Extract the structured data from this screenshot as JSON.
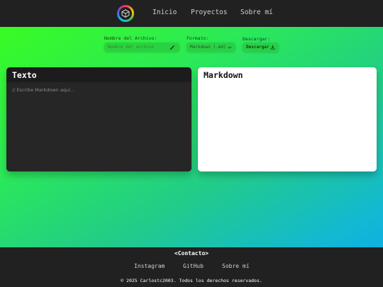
{
  "nav": {
    "logo_icon": "colorful-polyhedron-icon",
    "links": [
      "Inicio",
      "Proyectos",
      "Sobre mí"
    ]
  },
  "controls": {
    "filename_label": "Nombre del Archivo:",
    "filename_placeholder": "Nombre del archivo",
    "filename_icon": "pencil-icon",
    "format_label": "Formato:",
    "format_selected": "Markdown (.md)",
    "format_icon": "chevron-down-icon",
    "download_label": "Descargar:",
    "download_button": "Descargar",
    "download_icon": "download-icon"
  },
  "editor": {
    "title": "Texto",
    "placeholder": "// Escribe Markdown aquí..."
  },
  "preview": {
    "title": "Markdown"
  },
  "footer": {
    "title": "<Contacto>",
    "links": [
      "Instagram",
      "GitHub",
      "Sobre mí"
    ],
    "copyright": "© 2025 Carlostc2003. Todos los derechos reservados."
  },
  "colors": {
    "navbar": "#212121",
    "gradient_start": "#3bff1a",
    "gradient_end": "#0aa8ee",
    "control_bg": "#28c83c"
  }
}
